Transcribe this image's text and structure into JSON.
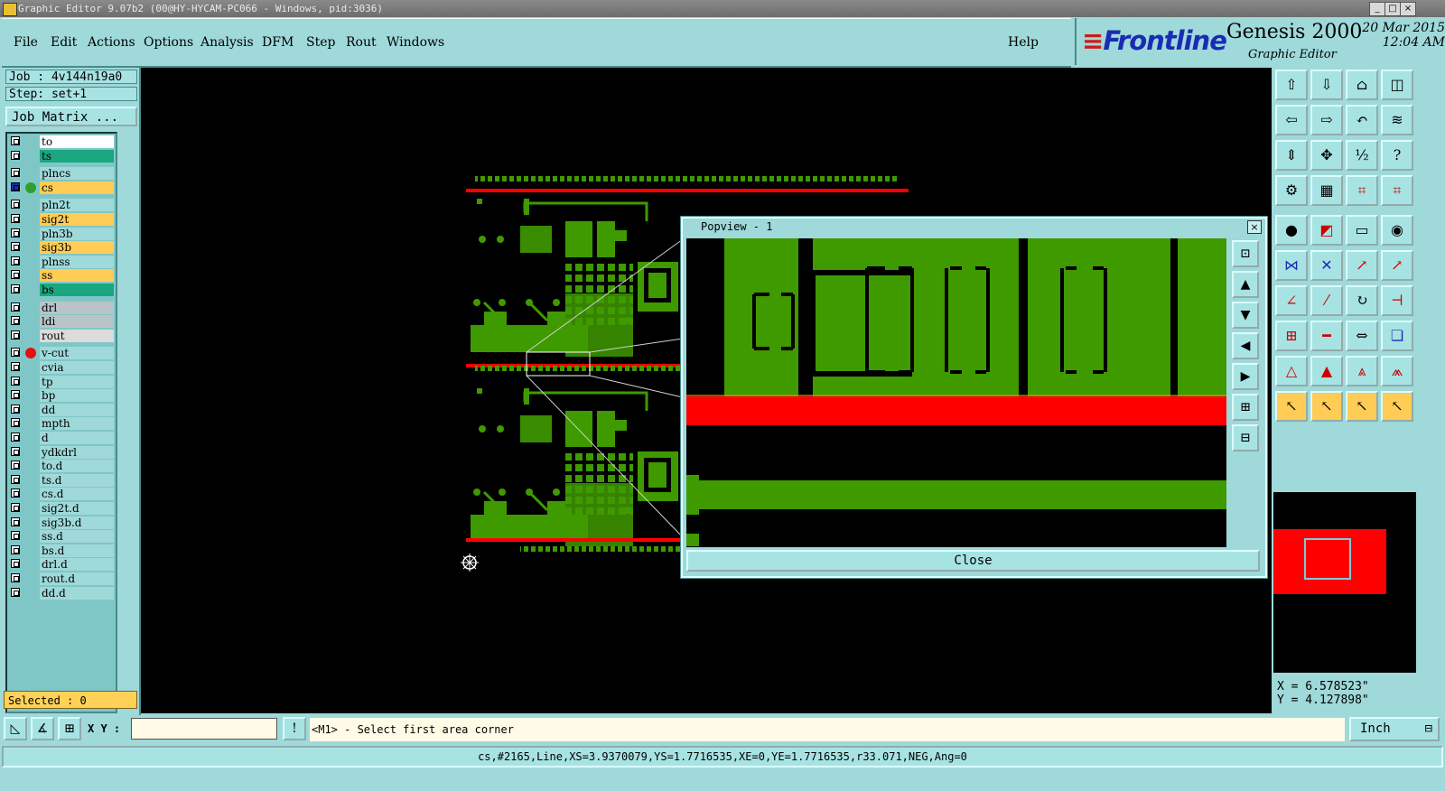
{
  "window": {
    "title": "Graphic Editor 9.07b2 (00@HY-HYCAM-PC066 - Windows, pid:3036)",
    "controls": [
      "_",
      "□",
      "×"
    ]
  },
  "menu": [
    "File",
    "Edit",
    "Actions",
    "Options",
    "Analysis",
    "DFM",
    "Step",
    "Rout",
    "Windows"
  ],
  "help_label": "Help",
  "brand": {
    "logo": "Frontline",
    "product": "Genesis 2000",
    "subtitle": "Graphic Editor",
    "date": "20 Mar 2015",
    "time": "12:04 AM"
  },
  "job": {
    "job_label": "Job : 4v144n19a0",
    "step_label": "Step: set+1",
    "job_matrix_button": "Job Matrix ..."
  },
  "layers": [
    {
      "name": "to",
      "color": "#ffffff"
    },
    {
      "name": "ts",
      "color": "#1aa67f"
    },
    {
      "name": "plncs",
      "color": "#9fd9d9"
    },
    {
      "name": "cs",
      "color": "#ffcc55",
      "active": true,
      "marker": "#2da02d"
    },
    {
      "name": "pln2t",
      "color": "#9fd9d9"
    },
    {
      "name": "sig2t",
      "color": "#ffcc55"
    },
    {
      "name": "pln3b",
      "color": "#9fd9d9"
    },
    {
      "name": "sig3b",
      "color": "#ffcc55"
    },
    {
      "name": "plnss",
      "color": "#9fd9d9"
    },
    {
      "name": "ss",
      "color": "#ffcc55"
    },
    {
      "name": "bs",
      "color": "#1aa67f"
    },
    {
      "name": "drl",
      "color": "#b8c4c8"
    },
    {
      "name": "ldi",
      "color": "#b8c4c8"
    },
    {
      "name": "rout",
      "color": "#dcdcdc"
    },
    {
      "name": "v-cut",
      "color": "#9fd9d9",
      "marker": "#e51010"
    },
    {
      "name": "cvia",
      "color": "#9fd9d9"
    },
    {
      "name": "tp",
      "color": "#9fd9d9"
    },
    {
      "name": "bp",
      "color": "#9fd9d9"
    },
    {
      "name": "dd",
      "color": "#9fd9d9"
    },
    {
      "name": "mpth",
      "color": "#9fd9d9"
    },
    {
      "name": "d",
      "color": "#9fd9d9"
    },
    {
      "name": "ydkdrl",
      "color": "#9fd9d9"
    },
    {
      "name": "to.d",
      "color": "#9fd9d9"
    },
    {
      "name": "ts.d",
      "color": "#9fd9d9"
    },
    {
      "name": "cs.d",
      "color": "#9fd9d9"
    },
    {
      "name": "sig2t.d",
      "color": "#9fd9d9"
    },
    {
      "name": "sig3b.d",
      "color": "#9fd9d9"
    },
    {
      "name": "ss.d",
      "color": "#9fd9d9"
    },
    {
      "name": "bs.d",
      "color": "#9fd9d9"
    },
    {
      "name": "drl.d",
      "color": "#9fd9d9"
    },
    {
      "name": "rout.d",
      "color": "#9fd9d9"
    },
    {
      "name": "dd.d",
      "color": "#9fd9d9"
    }
  ],
  "selected_label": "Selected : 0",
  "popview": {
    "title": "Popview - 1",
    "close_button": "Close"
  },
  "cursor": {
    "x": "X = 6.578523\"",
    "y": "Y = 4.127898\""
  },
  "bottom": {
    "xy_label": "X Y :",
    "xy_value": "",
    "prompt": "<M1> - Select first area corner",
    "unit": "Inch"
  },
  "status": "cs,#2165,Line,XS=3.9370079,YS=1.7716535,XE=0,YE=1.7716535,r33.071,NEG,Ang=0",
  "colors": {
    "copper": "#3f9a00",
    "vcut": "#ff0000",
    "panel": "#9fd9d9",
    "highlight": "#ffcc55"
  }
}
